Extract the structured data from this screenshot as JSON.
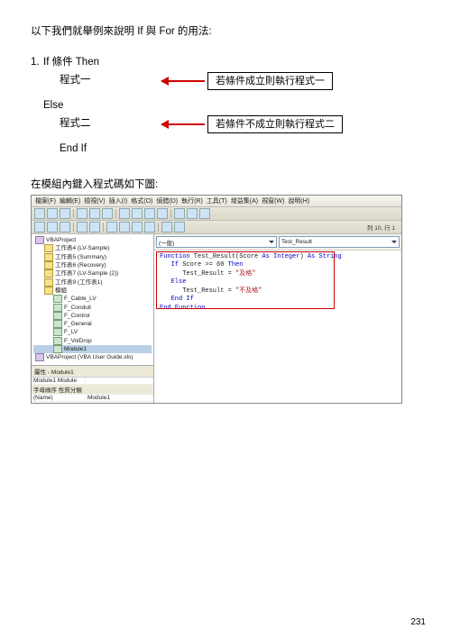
{
  "intro": "以下我們就舉例來說明 If 與 For 的用法:",
  "syntax": {
    "num": "1.",
    "l1": "If  條件  Then",
    "l2": "程式一",
    "l3": "Else",
    "l4": "程式二",
    "l5": "End If",
    "note1": "若條件成立則執行程式一",
    "note2": "若條件不成立則執行程式二"
  },
  "caption": "在模組內鍵入程式碼如下圖:",
  "ide": {
    "menu": [
      "檔案(F)",
      "編輯(E)",
      "檢視(V)",
      "插入(I)",
      "格式(O)",
      "偵錯(D)",
      "執行(R)",
      "工具(T)",
      "增益集(A)",
      "視窗(W)",
      "說明(H)"
    ],
    "status": "列 10, 行 1",
    "combo_left": "(一般)",
    "combo_right": "Test_Result",
    "tree": {
      "rows": [
        {
          "pad": "tv-pad0",
          "icon": "proj",
          "text": "VBAProject"
        },
        {
          "pad": "tv-pad1",
          "icon": "tree-icon",
          "text": "工作表4 (LV-Sample)"
        },
        {
          "pad": "tv-pad1",
          "icon": "tree-icon",
          "text": "工作表5 (Summary)"
        },
        {
          "pad": "tv-pad1",
          "icon": "tree-icon",
          "text": "工作表6 (Recovery)"
        },
        {
          "pad": "tv-pad1",
          "icon": "tree-icon",
          "text": "工作表7 (LV-Sample (2))"
        },
        {
          "pad": "tv-pad1",
          "icon": "tree-icon",
          "text": "工作表9 (工作表1)"
        },
        {
          "pad": "tv-pad1",
          "icon": "tree-icon",
          "text": "模組"
        },
        {
          "pad": "tv-pad2",
          "icon": "mod",
          "text": "F_Cable_LV"
        },
        {
          "pad": "tv-pad2",
          "icon": "mod",
          "text": "F_Conduit"
        },
        {
          "pad": "tv-pad2",
          "icon": "mod",
          "text": "F_Control"
        },
        {
          "pad": "tv-pad2",
          "icon": "mod",
          "text": "F_General"
        },
        {
          "pad": "tv-pad2",
          "icon": "mod",
          "text": "F_LV"
        },
        {
          "pad": "tv-pad2",
          "icon": "mod",
          "text": "F_VolDrop"
        },
        {
          "pad": "tv-pad2",
          "icon": "mod",
          "text": "Module1",
          "sel": true
        },
        {
          "pad": "tv-pad0",
          "icon": "proj",
          "text": "VBAProject (VBA User Guide.xls)"
        }
      ]
    },
    "prop": {
      "header": "屬性 - Module1",
      "name_row": "Module1  Module",
      "tab": "字母順序  性質分類",
      "k1": "(Name)",
      "v1": "Module1"
    }
  },
  "code": {
    "l1a": "Function",
    "l1b": " Test_Result(Score ",
    "l1c": "As Integer",
    "l1d": ") ",
    "l1e": "As String",
    "l2a": "   If",
    "l2b": " Score >= 60 ",
    "l2c": "Then",
    "l3a": "      Test_Result = ",
    "l3b": "\"及格\"",
    "l4a": "   Else",
    "l5a": "      Test_Result = ",
    "l5b": "\"不及格\"",
    "l6a": "   End If",
    "l7a": "End Function"
  },
  "page_number": "231"
}
